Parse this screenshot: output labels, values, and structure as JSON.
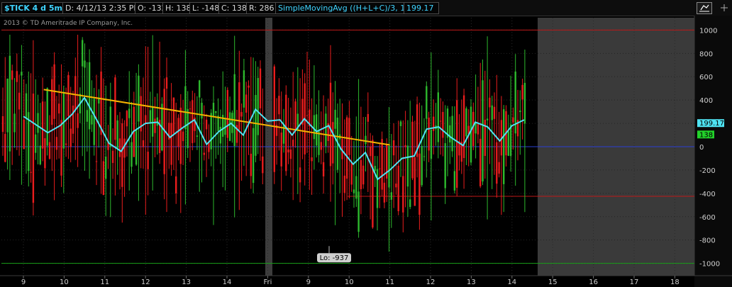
{
  "header": {
    "symbol": "$TICK 4 d 5m",
    "date_label": "D: 4/12/13 2:35 PM",
    "open_label": "O: -132",
    "high_label": "H: 138",
    "low_label": "L: -148",
    "close_label": "C: 138",
    "range_label": "R: 286",
    "study_label": "SimpleMovingAvg ((H+L+C)/3, 10, 0)",
    "study_value": "199.17",
    "copyright": "2013 © TD Ameritrade IP Company, Inc."
  },
  "colors": {
    "up": "#2db82d",
    "down": "#e81d1d",
    "sma": "#4fe3f2",
    "trendline": "#f5b400",
    "zero_line": "#2a3fd4",
    "upper_line": "#c01818",
    "lower_line": "#18a018",
    "support_line": "#c01818",
    "future_area": "#3a3a3a"
  },
  "chart_data": {
    "type": "candlestick",
    "symbol": "$TICK",
    "interval": "5m",
    "span": "4 d",
    "x_tick_labels": [
      "9",
      "10",
      "11",
      "12",
      "13",
      "14",
      "Fri",
      "9",
      "10",
      "11",
      "12",
      "13",
      "14",
      "15",
      "16",
      "17",
      "18"
    ],
    "y_ticks": [
      1000,
      800,
      600,
      400,
      200,
      0,
      -200,
      -400,
      -600,
      -800,
      -1000
    ],
    "ylim": [
      -1120,
      1120
    ],
    "reference_lines": {
      "upper": 1000,
      "zero": 0,
      "lower": -1000,
      "support": -425
    },
    "trendline": {
      "start": [
        0.5,
        490
      ],
      "end": [
        9.0,
        15
      ]
    },
    "last_values": {
      "sma": "199.17",
      "close": "138"
    },
    "low_annotation": "Lo: -937",
    "sma_series": {
      "name": "SimpleMovingAvg ((H+L+C)/3, 10, 0)",
      "x": [
        0,
        0.3,
        0.6,
        0.9,
        1.2,
        1.5,
        1.8,
        2.1,
        2.4,
        2.7,
        3.0,
        3.3,
        3.6,
        3.9,
        4.2,
        4.5,
        4.8,
        5.1,
        5.4,
        5.7,
        6.0,
        6.3,
        6.6,
        6.9,
        7.2,
        7.5,
        7.8,
        8.1,
        8.4,
        8.7,
        9.0,
        9.3,
        9.6,
        9.9,
        10.2,
        10.5,
        10.8,
        11.1,
        11.4,
        11.7,
        12.0,
        12.3
      ],
      "y": [
        260,
        190,
        120,
        180,
        280,
        420,
        230,
        30,
        -40,
        130,
        200,
        210,
        80,
        160,
        230,
        20,
        130,
        200,
        100,
        320,
        220,
        230,
        100,
        240,
        130,
        180,
        -20,
        -150,
        -50,
        -280,
        -200,
        -100,
        -80,
        150,
        170,
        80,
        10,
        210,
        170,
        50,
        180,
        230
      ]
    }
  }
}
